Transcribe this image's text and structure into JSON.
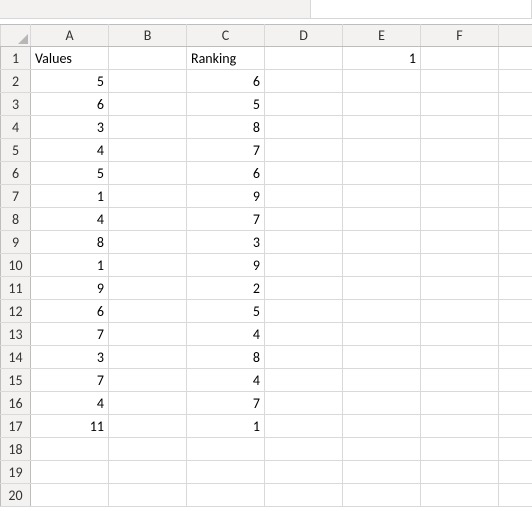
{
  "columns": [
    "A",
    "B",
    "C",
    "D",
    "E",
    "F"
  ],
  "partial_column": "",
  "row_count": 20,
  "cells": {
    "A1": {
      "v": "Values",
      "t": "text"
    },
    "C1": {
      "v": "Ranking",
      "t": "text"
    },
    "E1": {
      "v": "1",
      "t": "num"
    },
    "A2": {
      "v": "5",
      "t": "num"
    },
    "C2": {
      "v": "6",
      "t": "num"
    },
    "A3": {
      "v": "6",
      "t": "num"
    },
    "C3": {
      "v": "5",
      "t": "num"
    },
    "A4": {
      "v": "3",
      "t": "num"
    },
    "C4": {
      "v": "8",
      "t": "num"
    },
    "A5": {
      "v": "4",
      "t": "num"
    },
    "C5": {
      "v": "7",
      "t": "num"
    },
    "A6": {
      "v": "5",
      "t": "num"
    },
    "C6": {
      "v": "6",
      "t": "num"
    },
    "A7": {
      "v": "1",
      "t": "num"
    },
    "C7": {
      "v": "9",
      "t": "num"
    },
    "A8": {
      "v": "4",
      "t": "num"
    },
    "C8": {
      "v": "7",
      "t": "num"
    },
    "A9": {
      "v": "8",
      "t": "num"
    },
    "C9": {
      "v": "3",
      "t": "num"
    },
    "A10": {
      "v": "1",
      "t": "num"
    },
    "C10": {
      "v": "9",
      "t": "num"
    },
    "A11": {
      "v": "9",
      "t": "num"
    },
    "C11": {
      "v": "2",
      "t": "num"
    },
    "A12": {
      "v": "6",
      "t": "num"
    },
    "C12": {
      "v": "5",
      "t": "num"
    },
    "A13": {
      "v": "7",
      "t": "num"
    },
    "C13": {
      "v": "4",
      "t": "num"
    },
    "A14": {
      "v": "3",
      "t": "num"
    },
    "C14": {
      "v": "8",
      "t": "num"
    },
    "A15": {
      "v": "7",
      "t": "num"
    },
    "C15": {
      "v": "4",
      "t": "num"
    },
    "A16": {
      "v": "4",
      "t": "num"
    },
    "C16": {
      "v": "7",
      "t": "num"
    },
    "A17": {
      "v": "11",
      "t": "num"
    },
    "C17": {
      "v": "1",
      "t": "num"
    }
  }
}
